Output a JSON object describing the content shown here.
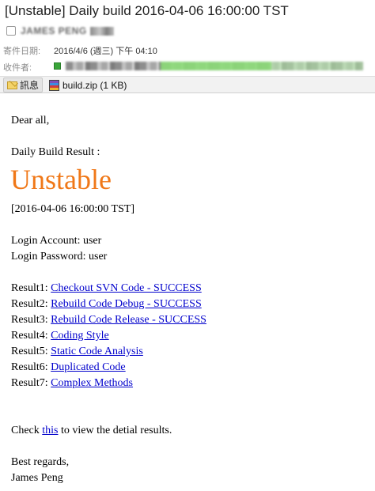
{
  "header": {
    "subject": "[Unstable] Daily build 2016-04-06 16:00:00 TST",
    "sender_name": "JAMES PENG",
    "date_label": "寄件日期:",
    "date_value": "2016/4/6 (週三) 下午 04:10",
    "recipient_label": "收件者:"
  },
  "attachments": {
    "message_tab_label": "訊息",
    "file_label": "build.zip (1 KB)"
  },
  "body": {
    "greeting": "Dear all,",
    "result_heading": "Daily Build Result :",
    "status": "Unstable",
    "timestamp": "[2016-04-06 16:00:00 TST]",
    "login_account": "Login Account: user",
    "login_password": "Login Password: user",
    "results": [
      {
        "label": "Result1:",
        "link": "Checkout SVN Code - SUCCESS"
      },
      {
        "label": "Result2:",
        "link": "Rebuild Code Debug - SUCCESS"
      },
      {
        "label": "Result3:",
        "link": "Rebuild Code Release - SUCCESS"
      },
      {
        "label": "Result4:",
        "link": "Coding Style"
      },
      {
        "label": "Result5:",
        "link": "Static Code Analysis"
      },
      {
        "label": "Result6:",
        "link": "Duplicated Code"
      },
      {
        "label": "Result7:",
        "link": "Complex Methods"
      }
    ],
    "check_prefix": "Check",
    "check_link": "this",
    "check_suffix": "to view the detial results.",
    "closing": "Best regards,",
    "signature": "James Peng"
  },
  "colors": {
    "status_color": "#f07818",
    "link_color": "#0000cc"
  },
  "icons": {
    "message": "envelope-icon",
    "attachment": "zip-archive-icon",
    "recipient_status": "presence-green-icon"
  }
}
